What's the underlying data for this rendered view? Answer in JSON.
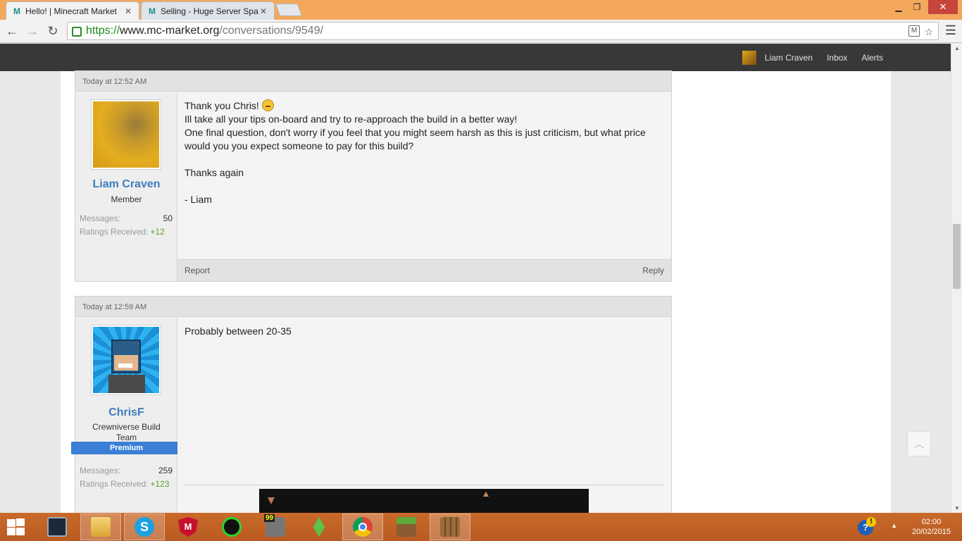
{
  "browser": {
    "tabs": [
      {
        "title": "Hello! | Minecraft Market",
        "active": true
      },
      {
        "title": "Selling - Huge Server Spav",
        "active": false
      }
    ],
    "url": {
      "scheme": "https://",
      "host": "www.mc-market.org",
      "path": "/conversations/9549/"
    },
    "icons": {
      "back": "back-arrow-icon",
      "forward": "forward-arrow-icon",
      "reload": "reload-icon",
      "star": "star-icon",
      "menu": "hamburger-menu-icon"
    }
  },
  "sitebar": {
    "user": "Liam Craven",
    "inbox": "Inbox",
    "alerts": "Alerts"
  },
  "messages": [
    {
      "time": "Today at 12:52 AM",
      "username": "Liam Craven",
      "usertitle": "Member",
      "stats": {
        "messages_label": "Messages:",
        "messages": "50",
        "ratings_label": "Ratings Received:",
        "ratings": "+12"
      },
      "lines": {
        "l1": "Thank you Chris!",
        "l2": "Ill take all your tips on-board and try to re-approach the build in a better way!",
        "l3": "One final question, don't worry if you feel that you might seem harsh as this is just criticism, but what price would you you expect someone to pay for this build?",
        "l4": "Thanks again",
        "l5": "- Liam"
      },
      "footer": {
        "report": "Report",
        "reply": "Reply"
      }
    },
    {
      "time": "Today at 12:59 AM",
      "username": "ChrisF",
      "usertitle": "Crewniverse Build Team",
      "badge": "Premium",
      "stats": {
        "messages_label": "Messages:",
        "messages": "259",
        "ratings_label": "Ratings Received:",
        "ratings": "+123"
      },
      "lines": {
        "l1": "Probably between 20-35"
      }
    }
  ],
  "taskbar": {
    "clock_time": "02:00",
    "clock_date": "20/02/2015",
    "badge_99": "99"
  },
  "colors": {
    "accent": "#3e7dbf",
    "positive": "#5aa02c",
    "premium": "#3a7fd5",
    "taskbar": "#c96a2a"
  }
}
